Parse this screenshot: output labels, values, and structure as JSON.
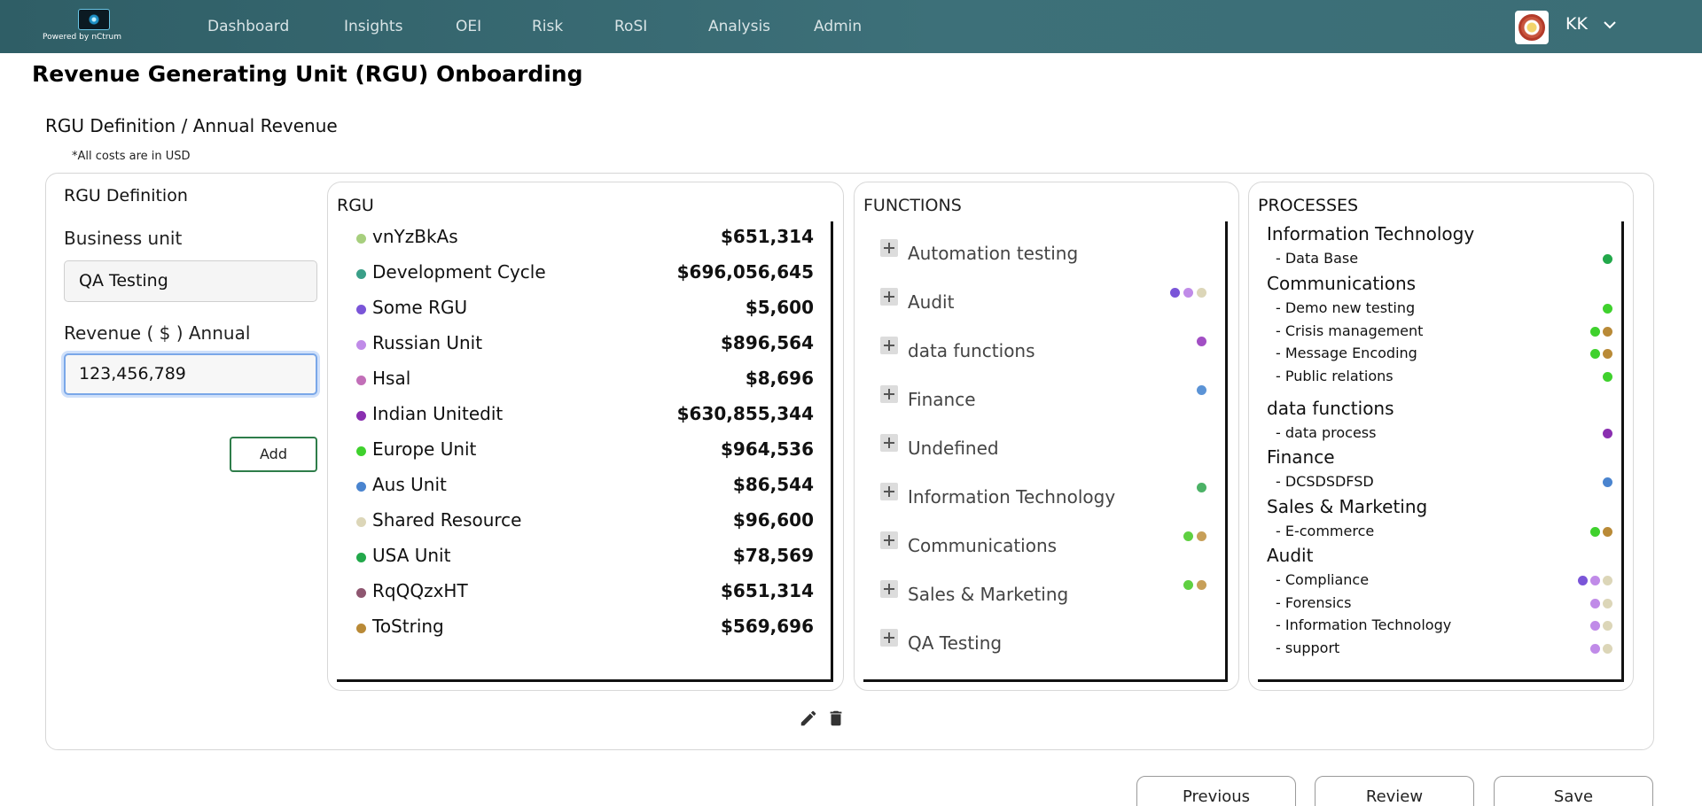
{
  "header": {
    "logo_text": "Powered by",
    "logo_brand": "nCtrum",
    "nav": [
      "Dashboard",
      "Insights",
      "OEI",
      "Risk",
      "RoSI",
      "Analysis",
      "Admin"
    ],
    "user_initials": "KK"
  },
  "page": {
    "title": "Revenue Generating Unit (RGU) Onboarding",
    "section_title": "RGU Definition / Annual Revenue",
    "cost_note": "*All costs are in USD"
  },
  "definition": {
    "title": "RGU Definition",
    "business_unit_label": "Business unit",
    "business_unit_value": "QA Testing",
    "revenue_label": "Revenue ( $ ) Annual",
    "revenue_value": "123,456,789",
    "add_label": "Add"
  },
  "rgu": {
    "title": "RGU",
    "items": [
      {
        "name": "vnYzBkAs",
        "value": "$651,314",
        "color": "#a7cf7e"
      },
      {
        "name": "Development Cycle",
        "value": "$696,056,645",
        "color": "#3a9f88"
      },
      {
        "name": "Some RGU",
        "value": "$5,600",
        "color": "#7a55d8"
      },
      {
        "name": "Russian Unit",
        "value": "$896,564",
        "color": "#c08be8"
      },
      {
        "name": "Hsal",
        "value": "$8,696",
        "color": "#c26fb8"
      },
      {
        "name": "Indian Unitedit",
        "value": "$630,855,344",
        "color": "#8a2fb0"
      },
      {
        "name": "Europe Unit",
        "value": "$964,536",
        "color": "#3fd12d"
      },
      {
        "name": "Aus Unit",
        "value": "$86,544",
        "color": "#4a84cf"
      },
      {
        "name": "Shared Resource",
        "value": "$96,600",
        "color": "#dcd6b8"
      },
      {
        "name": "USA Unit",
        "value": "$78,569",
        "color": "#22a84a"
      },
      {
        "name": "RqQQzxHT",
        "value": "$651,314",
        "color": "#8e5670"
      },
      {
        "name": "ToString",
        "value": "$569,696",
        "color": "#b98a37"
      }
    ]
  },
  "functions": {
    "title": "FUNCTIONS",
    "items": [
      {
        "name": "Automation testing",
        "dots": []
      },
      {
        "name": "Audit",
        "dots": [
          "#7a55d8",
          "#c08be8",
          "#dcd6b8"
        ]
      },
      {
        "name": "data functions",
        "dots": [
          "#a24fc4"
        ]
      },
      {
        "name": "Finance",
        "dots": [
          "#5b93d6"
        ]
      },
      {
        "name": "Undefined",
        "dots": []
      },
      {
        "name": "Information Technology",
        "dots": [
          "#4cb266"
        ]
      },
      {
        "name": "Communications",
        "dots": [
          "#5fd041",
          "#c79f58"
        ]
      },
      {
        "name": "Sales & Marketing",
        "dots": [
          "#5fd041",
          "#c79f58"
        ]
      },
      {
        "name": "QA Testing",
        "dots": []
      }
    ]
  },
  "processes": {
    "title": "PROCESSES",
    "groups": [
      {
        "name": "Information Technology",
        "items": [
          {
            "name": "- Data Base",
            "dots": [
              "#22a84a"
            ]
          }
        ]
      },
      {
        "name": "Communications",
        "items": [
          {
            "name": "- Demo new testing",
            "dots": [
              "#3fd12d"
            ]
          },
          {
            "name": "- Crisis management",
            "dots": [
              "#3fd12d",
              "#b98a37"
            ]
          },
          {
            "name": "- Message Encoding",
            "dots": [
              "#3fd12d",
              "#b98a37"
            ]
          },
          {
            "name": "- Public relations",
            "dots": [
              "#3fd12d"
            ]
          }
        ]
      },
      {
        "name": "data functions",
        "items": [
          {
            "name": "- data process",
            "dots": [
              "#8a2fb0"
            ]
          }
        ]
      },
      {
        "name": "Finance",
        "items": [
          {
            "name": "- DCSDSDFSD",
            "dots": [
              "#4a84cf"
            ]
          }
        ]
      },
      {
        "name": "Sales & Marketing",
        "items": [
          {
            "name": "- E-commerce",
            "dots": [
              "#3fd12d",
              "#b98a37"
            ]
          }
        ]
      },
      {
        "name": "Audit",
        "items": [
          {
            "name": "- Compliance",
            "dots": [
              "#7a55d8",
              "#c08be8",
              "#dcd6b8"
            ]
          },
          {
            "name": "- Forensics",
            "dots": [
              "#c08be8",
              "#dcd6b8"
            ]
          },
          {
            "name": "- Information Technology",
            "dots": [
              "#c08be8",
              "#dcd6b8"
            ]
          },
          {
            "name": "- support",
            "dots": [
              "#c08be8",
              "#dcd6b8"
            ]
          }
        ]
      }
    ]
  },
  "footer": {
    "previous": "Previous",
    "review": "Review",
    "save": "Save"
  }
}
